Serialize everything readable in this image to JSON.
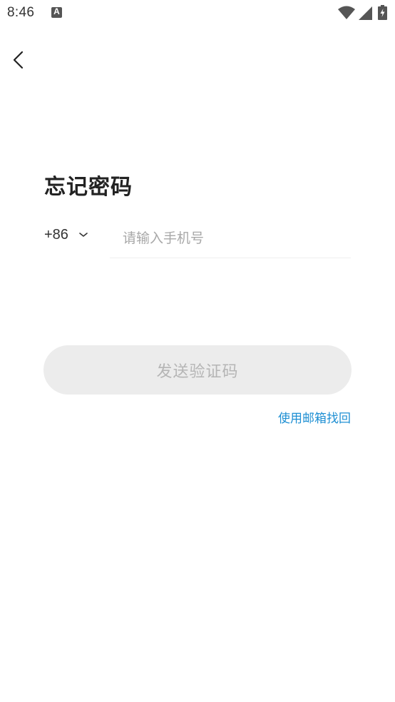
{
  "status_bar": {
    "time": "8:46",
    "notification_icon": "app-notification-icon",
    "icons": [
      "wifi-icon",
      "signal-icon",
      "battery-charging-icon"
    ]
  },
  "header": {
    "back_icon": "chevron-left-icon"
  },
  "page": {
    "title": "忘记密码"
  },
  "phone": {
    "country_code": "+86",
    "country_code_icon": "chevron-down-icon",
    "placeholder": "请输入手机号",
    "value": ""
  },
  "actions": {
    "send_code_label": "发送验证码",
    "email_recover_label": "使用邮箱找回"
  },
  "colors": {
    "link": "#1e8fd3",
    "button_disabled_bg": "#ececec",
    "button_disabled_text": "#b5b5b5",
    "title": "#222222"
  }
}
